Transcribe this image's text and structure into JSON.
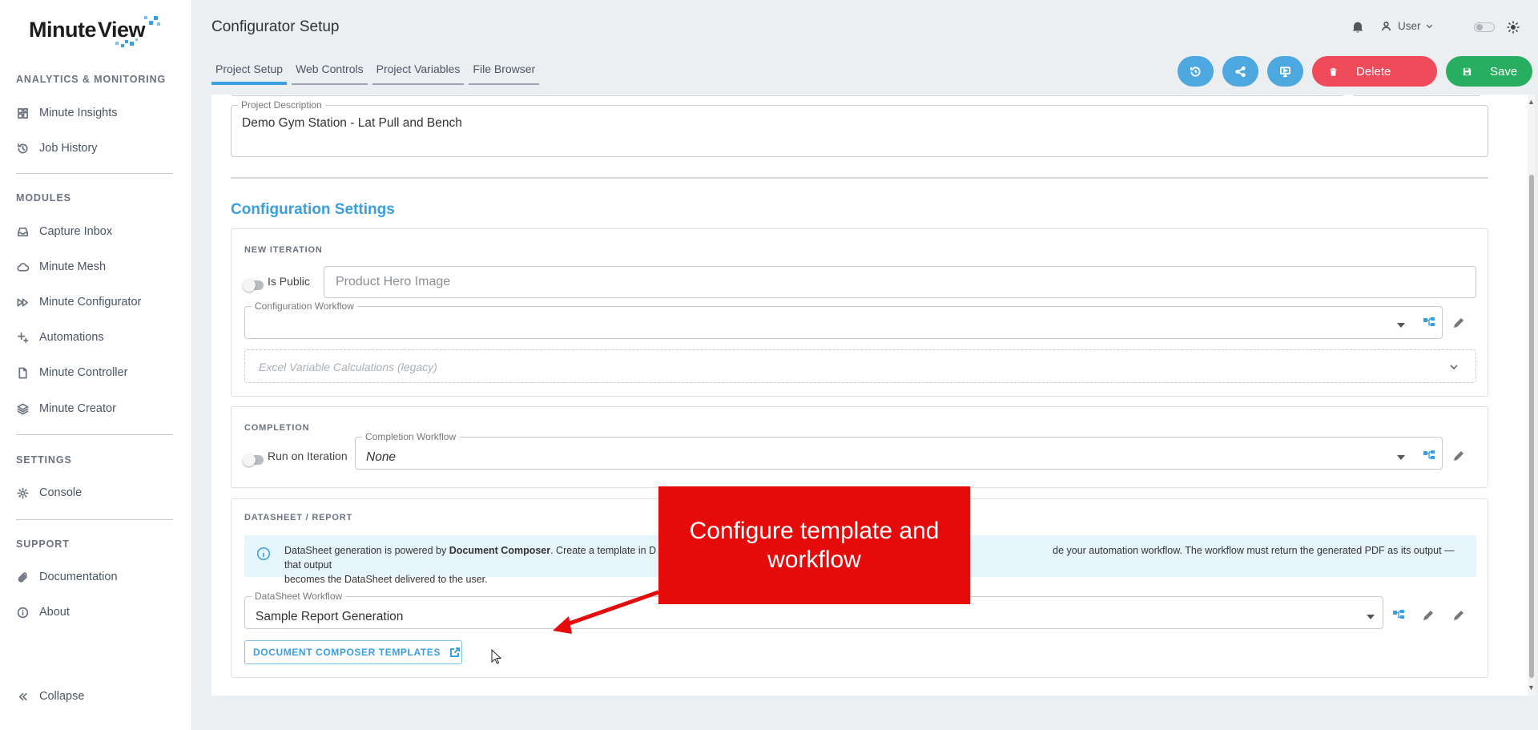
{
  "brand": {
    "logo_text": "MinuteView"
  },
  "sidebar": {
    "sections": {
      "analytics": "ANALYTICS & MONITORING",
      "modules": "MODULES",
      "settings": "SETTINGS",
      "support": "SUPPORT"
    },
    "items": [
      {
        "label": "Minute Insights",
        "icon": "dashboard-icon"
      },
      {
        "label": "Job History",
        "icon": "history-icon"
      },
      {
        "label": "Capture Inbox",
        "icon": "inbox-icon"
      },
      {
        "label": "Minute Mesh",
        "icon": "cloud-icon"
      },
      {
        "label": "Minute Configurator",
        "icon": "fast-forward-icon"
      },
      {
        "label": "Automations",
        "icon": "sparkles-icon"
      },
      {
        "label": "Minute Controller",
        "icon": "file-icon"
      },
      {
        "label": "Minute Creator",
        "icon": "layers-icon"
      },
      {
        "label": "Console",
        "icon": "gear-icon"
      },
      {
        "label": "Documentation",
        "icon": "paperclip-icon"
      },
      {
        "label": "About",
        "icon": "info-icon"
      }
    ],
    "collapse_label": "Collapse"
  },
  "header": {
    "title": "Configurator Setup",
    "user_label": "User",
    "tabs": [
      {
        "label": "Project Setup",
        "active": true
      },
      {
        "label": "Web Controls",
        "active": false
      },
      {
        "label": "Project Variables",
        "active": false
      },
      {
        "label": "File Browser",
        "active": false
      }
    ],
    "actions": {
      "delete_label": "Delete",
      "save_label": "Save"
    }
  },
  "colors": {
    "accent": "#3a9ee0",
    "delete": "#ef4b5b",
    "save": "#27ae60",
    "callout": "#e60b0b"
  },
  "project": {
    "description_label": "Project Description",
    "description_value": "Demo Gym Station - Lat Pull and Bench"
  },
  "config": {
    "section_title": "Configuration Settings",
    "new_iteration": {
      "label": "NEW ITERATION",
      "is_public_label": "Is Public",
      "name_placeholder": "Product Hero Image",
      "workflow_label": "Configuration Workflow",
      "workflow_value": "",
      "excel_placeholder": "Excel Variable Calculations (legacy)"
    },
    "completion": {
      "label": "COMPLETION",
      "run_on_iteration_label": "Run on Iteration",
      "workflow_label": "Completion Workflow",
      "workflow_value": "None"
    },
    "datasheet": {
      "label": "DATASHEET / REPORT",
      "info_prefix": "DataSheet generation is powered by ",
      "info_bold": "Document Composer",
      "info_middle": ". Create a template in D",
      "info_suffix": "de your automation workflow. The workflow must return the generated PDF as its output — that output",
      "info_line2": "becomes the DataSheet delivered to the user.",
      "workflow_label": "DataSheet Workflow",
      "workflow_value": "Sample Report Generation",
      "templates_button": "DOCUMENT COMPOSER TEMPLATES"
    }
  },
  "annotation": {
    "callout_text": "Configure template and workflow"
  }
}
